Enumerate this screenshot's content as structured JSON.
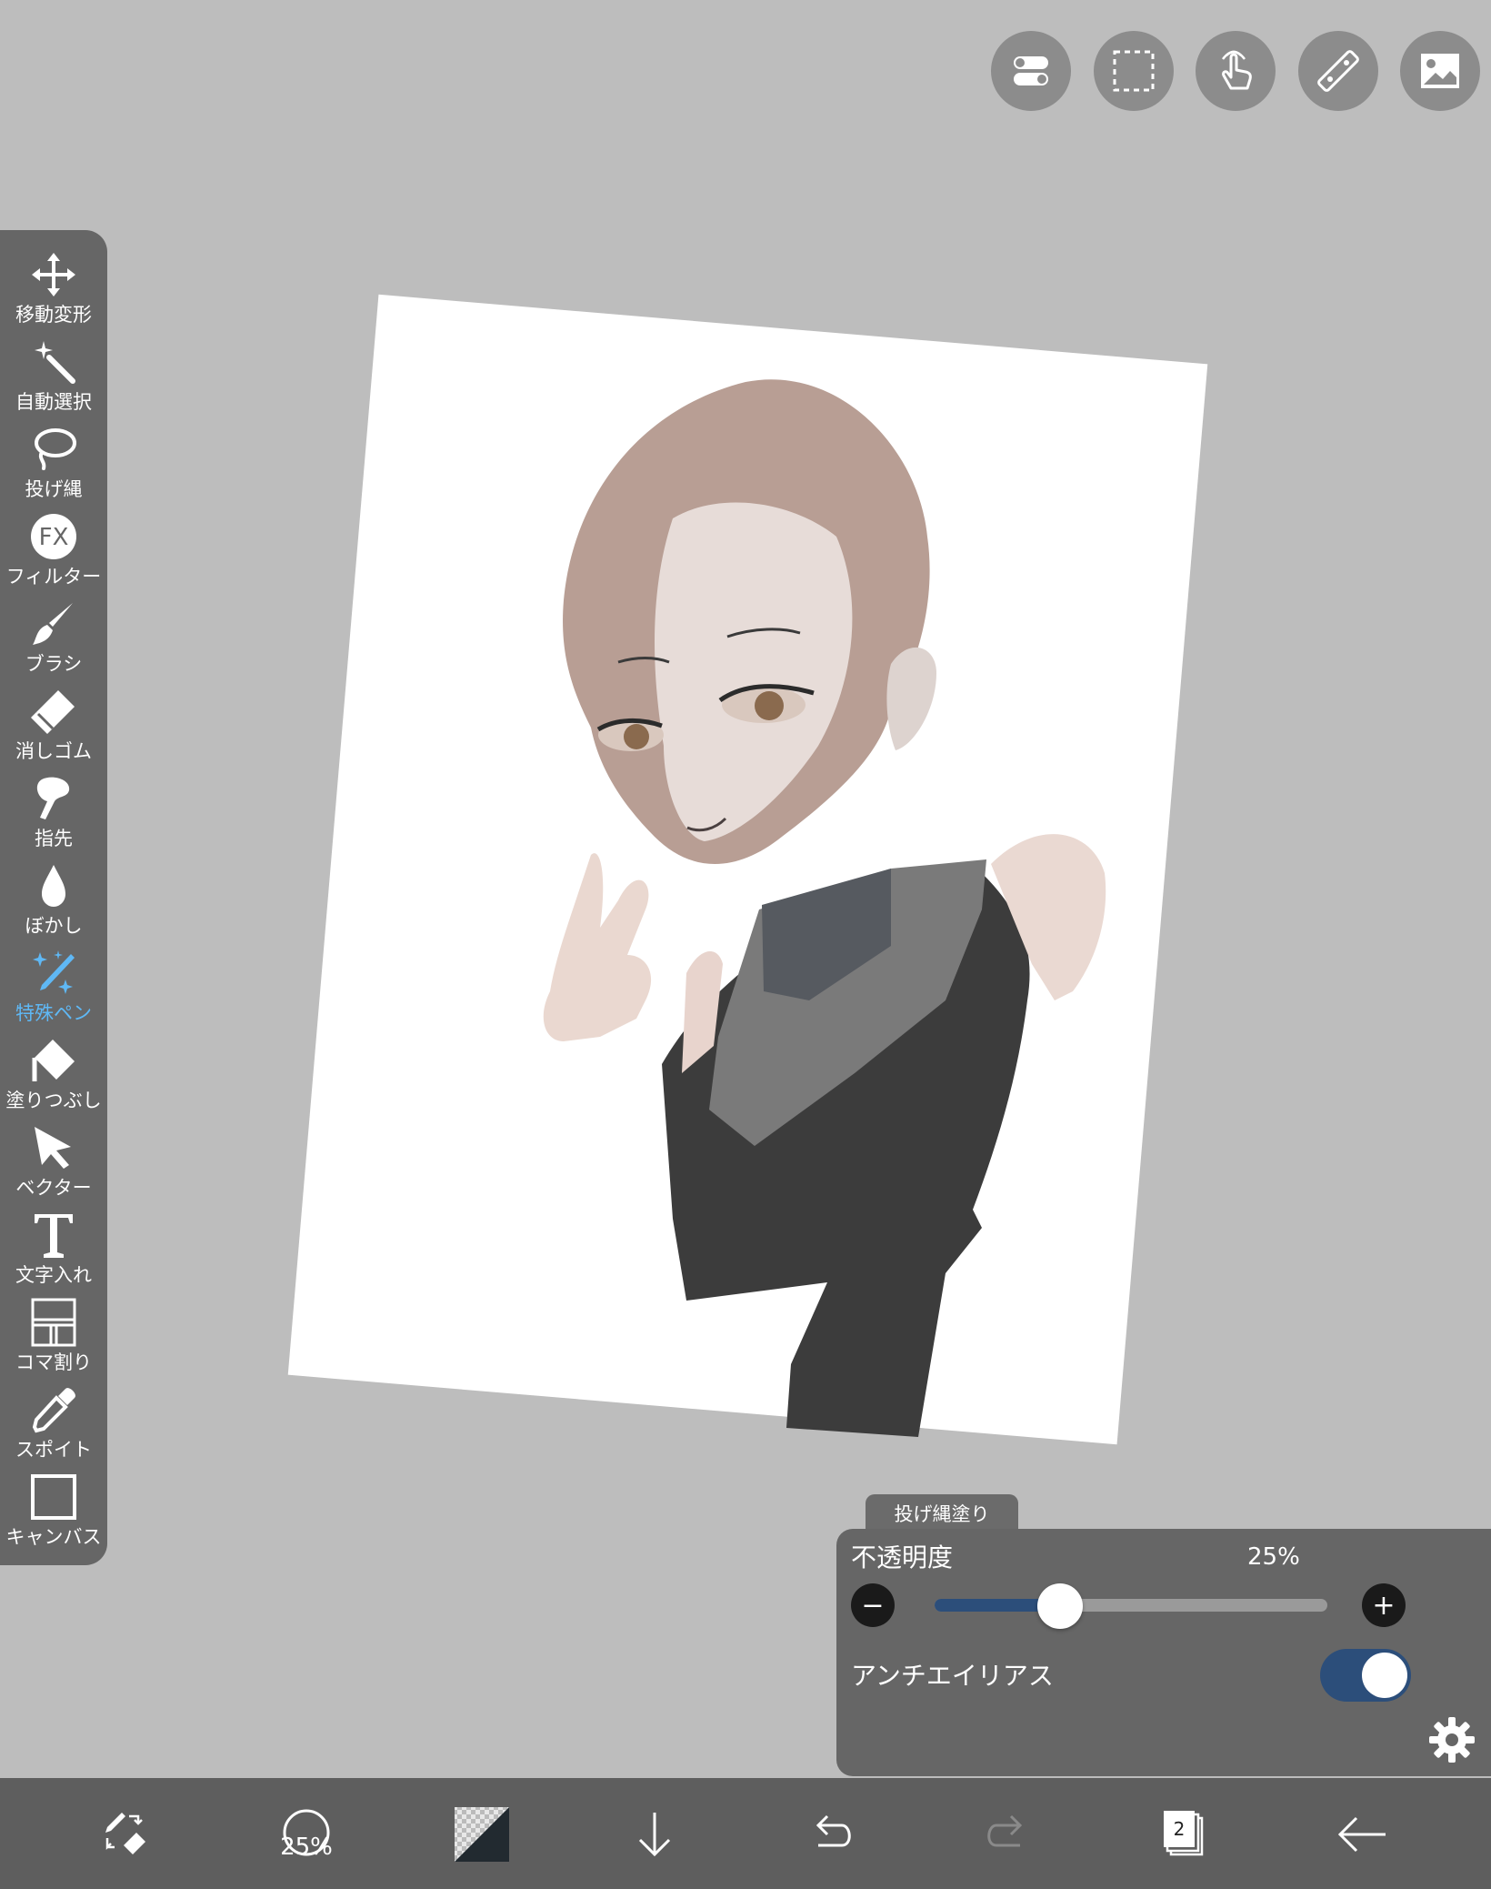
{
  "toolbar": {
    "tools": [
      {
        "label": "移動変形",
        "icon": "move-transform-icon"
      },
      {
        "label": "自動選択",
        "icon": "magic-wand-icon"
      },
      {
        "label": "投げ縄",
        "icon": "lasso-icon"
      },
      {
        "label": "フィルター",
        "icon": "fx-filter-icon"
      },
      {
        "label": "ブラシ",
        "icon": "brush-icon"
      },
      {
        "label": "消しゴム",
        "icon": "eraser-icon"
      },
      {
        "label": "指先",
        "icon": "smudge-finger-icon"
      },
      {
        "label": "ぼかし",
        "icon": "blur-drop-icon"
      },
      {
        "label": "特殊ペン",
        "icon": "special-pen-icon",
        "active": true
      },
      {
        "label": "塗りつぶし",
        "icon": "fill-bucket-icon"
      },
      {
        "label": "ベクター",
        "icon": "vector-arrow-icon"
      },
      {
        "label": "文字入れ",
        "icon": "text-icon"
      },
      {
        "label": "コマ割り",
        "icon": "frame-divider-icon"
      },
      {
        "label": "スポイト",
        "icon": "eyedropper-icon"
      },
      {
        "label": "キャンバス",
        "icon": "canvas-icon"
      }
    ],
    "fx_text": "FX",
    "active_color": "#5fb8f5"
  },
  "top_buttons": [
    "toggle-settings-icon",
    "selection-icon",
    "gesture-hand-icon",
    "ruler-icon",
    "material-image-icon"
  ],
  "panel": {
    "tab_label": "投げ縄塗り",
    "opacity_label": "不透明度",
    "opacity_value": "25%",
    "opacity_fraction": 0.25,
    "minus": "−",
    "plus": "+",
    "antialias_label": "アンチエイリアス",
    "antialias_on": true,
    "accent": "#2c4e7a"
  },
  "bottom_bar": {
    "brush_size_text": "25%",
    "layer_count": "2",
    "icons": [
      "swap-pen-eraser-icon",
      "brush-size-icon",
      "color-swatch-icon",
      "download-arrow-icon",
      "undo-icon",
      "redo-icon",
      "layers-icon",
      "back-arrow-icon"
    ]
  }
}
